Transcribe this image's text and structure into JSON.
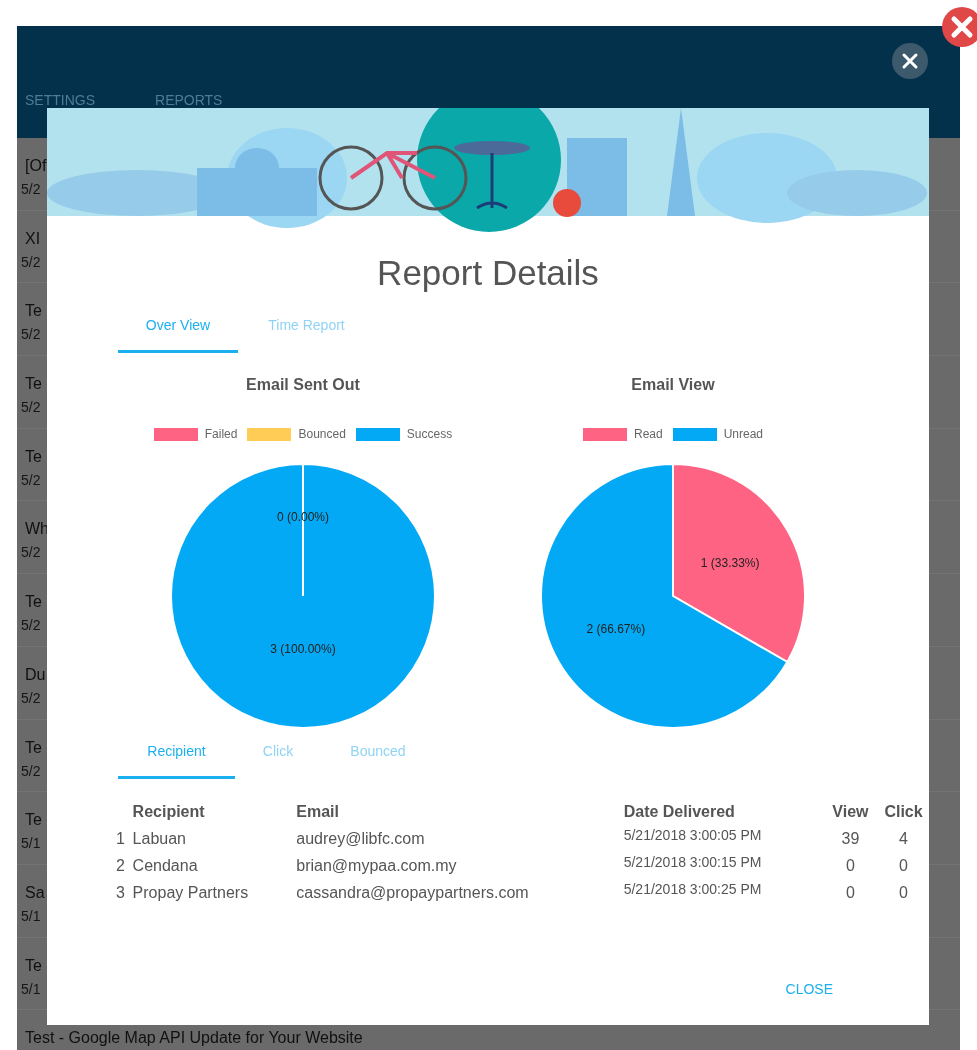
{
  "background_app": {
    "tabs": [
      {
        "label": "SETTINGS",
        "selected": false
      },
      {
        "label": "REPORTS",
        "selected": false
      }
    ],
    "list": [
      {
        "title": "[Of",
        "date": "5/2"
      },
      {
        "title": "XI",
        "date": "5/2"
      },
      {
        "title": "Te",
        "date": "5/2"
      },
      {
        "title": "Te",
        "date": "5/2"
      },
      {
        "title": "Te",
        "date": "5/2"
      },
      {
        "title": "Wh",
        "date": "5/2"
      },
      {
        "title": "Te",
        "date": "5/2"
      },
      {
        "title": "Du",
        "date": "5/2"
      },
      {
        "title": "Te",
        "date": "5/2"
      },
      {
        "title": "Te",
        "date": "5/1"
      },
      {
        "title": "Sa",
        "date": "5/1"
      },
      {
        "title": "Te",
        "date": "5/1"
      },
      {
        "title": "Test - Google Map API Update for Your Website"
      }
    ]
  },
  "dialog": {
    "title": "Report Details",
    "tabs": [
      {
        "label": "Over View",
        "selected": true
      },
      {
        "label": "Time Report",
        "selected": false
      }
    ],
    "charts": [
      {
        "legend": [
          {
            "color": "#ff6384"
          },
          {
            "color": "#ffcd56"
          },
          {
            "color": "#03a9f4"
          }
        ],
        "chart_data": {
          "type": "pie",
          "title": "Email Sent Out",
          "categories": [
            "Failed",
            "Bounced",
            "Success"
          ],
          "values": [
            0,
            0,
            3
          ],
          "value_labels": [
            "0 (0.00%)",
            null,
            "3 (100.00%)"
          ]
        }
      },
      {
        "legend": [
          {
            "color": "#ff6384"
          },
          {
            "color": "#03a9f4"
          }
        ],
        "chart_data": {
          "type": "pie",
          "title": "Email View",
          "categories": [
            "Read",
            "Unread"
          ],
          "values": [
            1,
            2
          ],
          "value_labels": [
            "1 (33.33%)",
            "2 (66.67%)"
          ]
        }
      }
    ],
    "detail_tabs": [
      {
        "label": "Recipient",
        "selected": true
      },
      {
        "label": "Click",
        "selected": false
      },
      {
        "label": "Bounced",
        "selected": false
      }
    ],
    "table": {
      "columns": [
        "Recipient",
        "Email",
        "Date Delivered",
        "View",
        "Click"
      ],
      "rows": [
        {
          "number": "1",
          "recipient": "Labuan",
          "email": "audrey@libfc.com",
          "date_delivered": "5/21/2018 3:00:05 PM",
          "view": "39",
          "click": "4"
        },
        {
          "number": "2",
          "recipient": "Cendana",
          "email": "brian@mypaa.com.my",
          "date_delivered": "5/21/2018 3:00:15 PM",
          "view": "0",
          "click": "0"
        },
        {
          "number": "3",
          "recipient": "Propay Partners",
          "email": "cassandra@propaypartners.com",
          "date_delivered": "5/21/2018 3:00:25 PM",
          "view": "0",
          "click": "0"
        }
      ]
    },
    "close_button": "CLOSE"
  }
}
